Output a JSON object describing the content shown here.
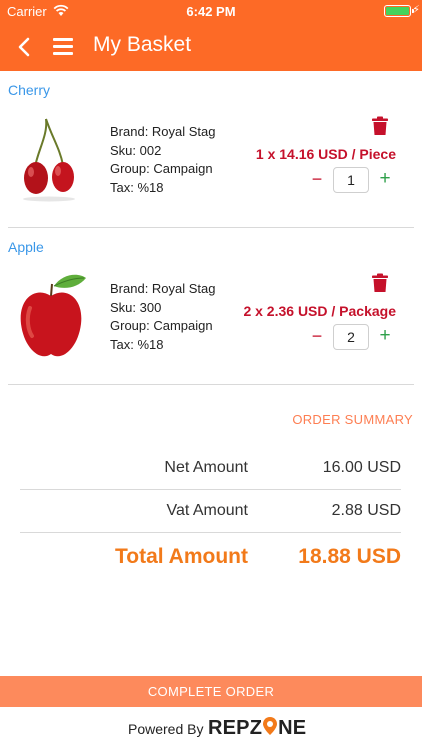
{
  "status_bar": {
    "carrier": "Carrier",
    "time": "6:42 PM"
  },
  "nav": {
    "title": "My Basket"
  },
  "items": [
    {
      "name": "Cherry",
      "brand": "Brand: Royal Stag",
      "sku": "Sku: 002",
      "group": "Group: Campaign",
      "tax": "Tax: %18",
      "price": "1 x 14.16 USD / Piece",
      "qty": "1"
    },
    {
      "name": "Apple",
      "brand": "Brand: Royal Stag",
      "sku": "Sku: 300",
      "group": "Group: Campaign",
      "tax": "Tax: %18",
      "price": "2 x 2.36 USD / Package",
      "qty": "2"
    }
  ],
  "stepper": {
    "minus": "−",
    "plus": "+"
  },
  "summary": {
    "title": "ORDER SUMMARY",
    "net_label": "Net Amount",
    "net_value": "16.00 USD",
    "vat_label": "Vat Amount",
    "vat_value": "2.88 USD",
    "total_label": "Total Amount",
    "total_value": "18.88 USD"
  },
  "actions": {
    "complete_label": "COMPLETE ORDER"
  },
  "footer": {
    "powered_by": "Powered By",
    "brand_a": "REPZ",
    "brand_b": "NE"
  },
  "colors": {
    "brand": "#fd6a26",
    "price_red": "#c5112b",
    "link_blue": "#3a97e8",
    "plus_green": "#2ea04a"
  }
}
